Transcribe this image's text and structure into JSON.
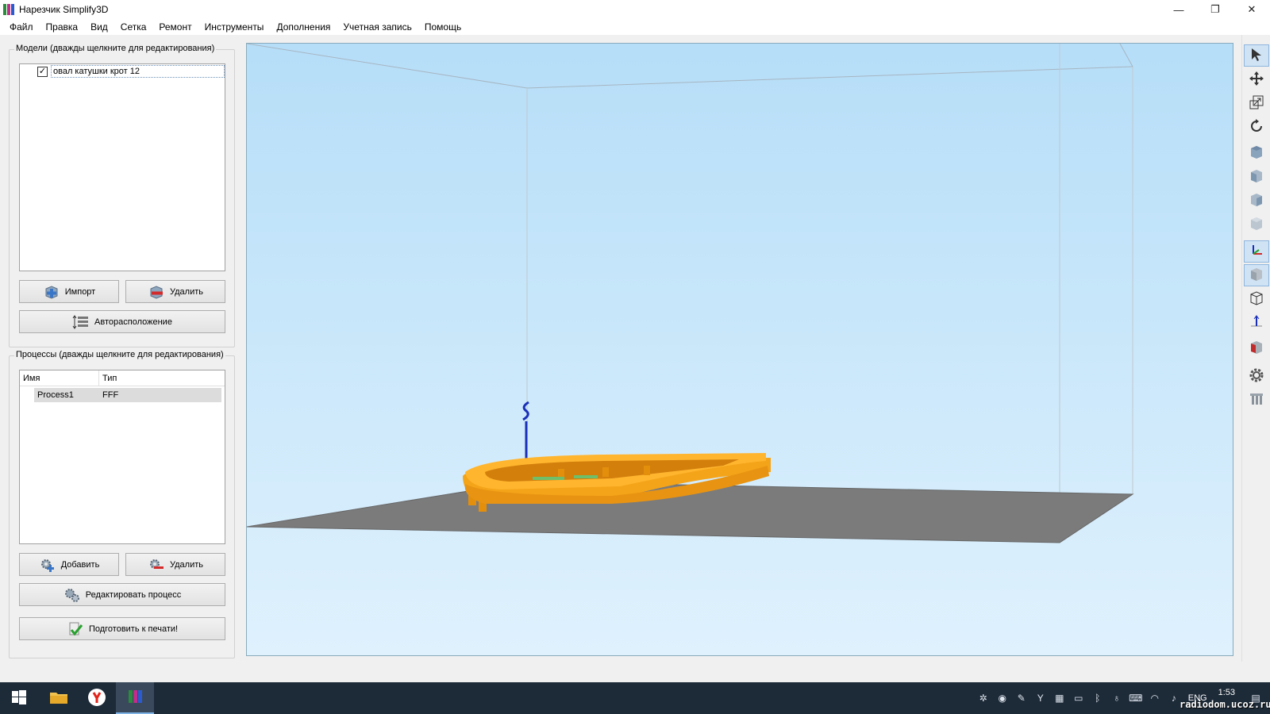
{
  "window": {
    "title": "Нарезчик Simplify3D",
    "minimize": "—",
    "maximize": "❐",
    "close": "✕"
  },
  "menu": [
    "Файл",
    "Правка",
    "Вид",
    "Сетка",
    "Ремонт",
    "Инструменты",
    "Дополнения",
    "Учетная запись",
    "Помощь"
  ],
  "models": {
    "group_title": "Модели (дважды щелкните для редактирования)",
    "items": [
      {
        "name": "овал катушки крот 12",
        "checked": true
      }
    ],
    "import_label": "Импорт",
    "remove_label": "Удалить",
    "auto_arrange_label": "Авторасположение"
  },
  "processes": {
    "group_title": "Процессы (дважды щелкните для редактирования)",
    "columns": [
      "Имя",
      "Тип"
    ],
    "rows": [
      {
        "name": "Process1",
        "type": "FFF"
      }
    ],
    "add_label": "Добавить",
    "remove_label": "Удалить",
    "edit_label": "Редактировать процесс",
    "prepare_label": "Подготовить к печати!"
  },
  "toolbar_icons": [
    "select-arrow-icon",
    "move-icon",
    "scale-icon",
    "rotate-icon",
    "view-iso-icon",
    "view-front-icon",
    "view-side-icon",
    "view-top-icon",
    "axes-icon",
    "solid-view-icon",
    "wireframe-icon",
    "normal-icon",
    "cross-section-icon",
    "settings-gear-icon",
    "support-icon"
  ],
  "taskbar": {
    "lang": "ENG",
    "time": "1:53",
    "watermark": "radiodom.ucoz.ru"
  },
  "colors": {
    "model": "#f7a31a",
    "bed": "#7d7d7d",
    "viewport_top": "#b6def8",
    "axis": "#1a2fb8",
    "taskbar": "#1d2a38"
  }
}
